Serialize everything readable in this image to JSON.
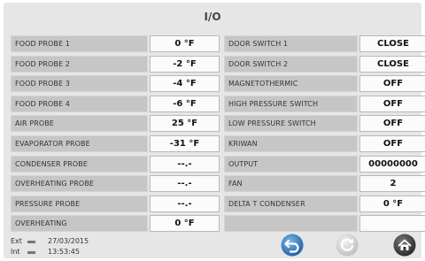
{
  "title": "I/O",
  "left_rows": [
    {
      "label": "FOOD PROBE 1",
      "value": "0 °F"
    },
    {
      "label": "FOOD PROBE 2",
      "value": "-2 °F"
    },
    {
      "label": "FOOD PROBE 3",
      "value": "-4 °F"
    },
    {
      "label": "FOOD PROBE 4",
      "value": "-6 °F"
    },
    {
      "label": "AIR PROBE",
      "value": "25 °F"
    },
    {
      "label": "EVAPORATOR PROBE",
      "value": "-31 °F"
    },
    {
      "label": "CONDENSER PROBE",
      "value": "--.-"
    },
    {
      "label": "OVERHEATING PROBE",
      "value": "--.-"
    },
    {
      "label": "PRESSURE PROBE",
      "value": "--.-"
    },
    {
      "label": "OVERHEATING",
      "value": "0 °F"
    }
  ],
  "right_rows": [
    {
      "label": "DOOR SWITCH 1",
      "value": "CLOSE"
    },
    {
      "label": "DOOR SWITCH 2",
      "value": "CLOSE"
    },
    {
      "label": "MAGNETOTHERMIC",
      "value": "OFF"
    },
    {
      "label": "HIGH PRESSURE SWITCH",
      "value": "OFF"
    },
    {
      "label": "LOW PRESSURE SWITCH",
      "value": "OFF"
    },
    {
      "label": "KRIWAN",
      "value": "OFF"
    },
    {
      "label": "OUTPUT",
      "value": "00000000"
    },
    {
      "label": "FAN",
      "value": "2"
    },
    {
      "label": "DELTA T CONDENSER",
      "value": "0 °F"
    },
    {
      "label": "",
      "value": ""
    }
  ],
  "footer": {
    "ext_label": "Ext",
    "int_label": "Int",
    "date": "27/03/2015",
    "time": "13:53:45"
  },
  "icons": {
    "back": "back-arrow-icon",
    "refresh": "refresh-icon",
    "home": "home-icon"
  },
  "colors": {
    "background": "#e6e6e6",
    "label_bg": "#c6c6c6",
    "value_bg": "#fbfbfb",
    "back_button": "#2f74b5",
    "refresh_button": "#cfcfcf",
    "home_button": "#3f3f3f"
  }
}
